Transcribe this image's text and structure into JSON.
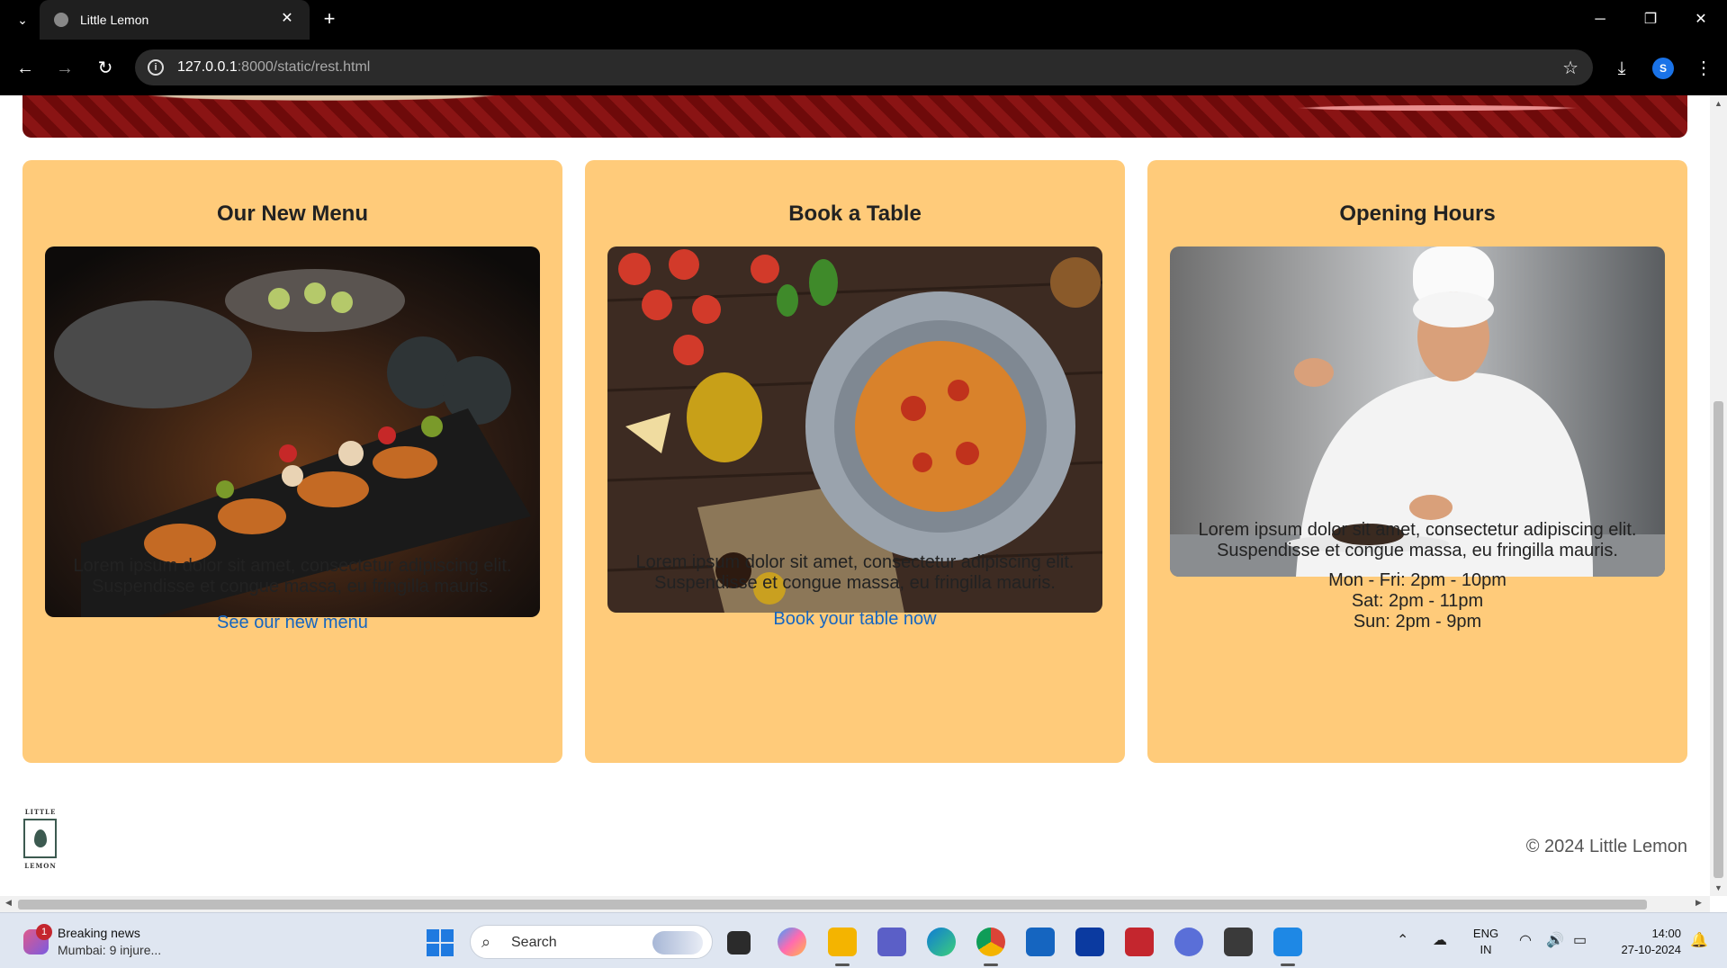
{
  "browser": {
    "tab_title": "Little Lemon",
    "url_host": "127.0.0.1",
    "url_rest": ":8000/static/rest.html",
    "profile_initial": "S"
  },
  "cards": [
    {
      "title": "Our New Menu",
      "text": "Lorem ipsum dolor sit amet, consectetur adipiscing elit. Suspendisse et congue massa, eu fringilla mauris.",
      "link": "See our new menu"
    },
    {
      "title": "Book a Table",
      "text": "Lorem ipsum dolor sit amet, consectetur adipiscing elit. Suspendisse et congue massa, eu fringilla mauris.",
      "link": "Book your table now"
    },
    {
      "title": "Opening Hours",
      "text": "Lorem ipsum dolor sit amet, consectetur adipiscing elit. Suspendisse et congue massa, eu fringilla mauris.",
      "hours": [
        "Mon - Fri: 2pm - 10pm",
        "Sat: 2pm - 11pm",
        "Sun: 2pm - 9pm"
      ]
    }
  ],
  "footer": {
    "logo_top": "LITTLE",
    "logo_bottom": "LEMON",
    "copyright": "© 2024 Little Lemon"
  },
  "taskbar": {
    "news_title": "Breaking news",
    "news_sub": "Mumbai: 9 injure...",
    "news_badge": "1",
    "search_label": "Search",
    "lang_1": "ENG",
    "lang_2": "IN",
    "time": "14:00",
    "date": "27-10-2024"
  },
  "colors": {
    "card_bg": "#ffcb7a",
    "link": "#1565c0",
    "browser_chrome": "#000000"
  }
}
